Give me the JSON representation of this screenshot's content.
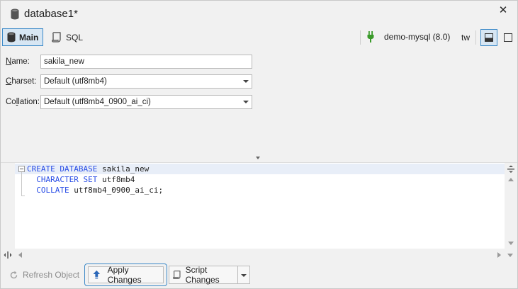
{
  "window": {
    "title": "database1*",
    "close_label": "✕"
  },
  "toolbar": {
    "tab_main": "Main",
    "tab_sql": "SQL",
    "connection": "demo-mysql (8.0)",
    "user": "tw",
    "colors": {
      "accent": "#3c89c8",
      "selected_bg": "#d7e6f3",
      "plug": "#3a9a2a"
    }
  },
  "form": {
    "name_label_prefix": "N",
    "name_label_rest": "ame:",
    "name_value": "sakila_new",
    "charset_label_prefix": "C",
    "charset_label_rest": "harset:",
    "charset_value": "Default (utf8mb4)",
    "collation_label_prefix": "Co",
    "collation_label_underline": "l",
    "collation_label_rest": "lation:",
    "collation_value": "Default (utf8mb4_0900_ai_ci)"
  },
  "editor": {
    "line1_kw": "CREATE DATABASE",
    "line1_rest": " sakila_new",
    "line2_indent": "  ",
    "line2_kw": "CHARACTER SET",
    "line2_rest": " utf8mb4",
    "line3_indent": "  ",
    "line3_kw": "COLLATE",
    "line3_rest": " utf8mb4_0900_ai_ci;",
    "keyword_color": "#2a4ee6"
  },
  "footer": {
    "refresh_label": "Refresh Object",
    "apply_label": "Apply Changes",
    "script_label": "Script Changes"
  }
}
